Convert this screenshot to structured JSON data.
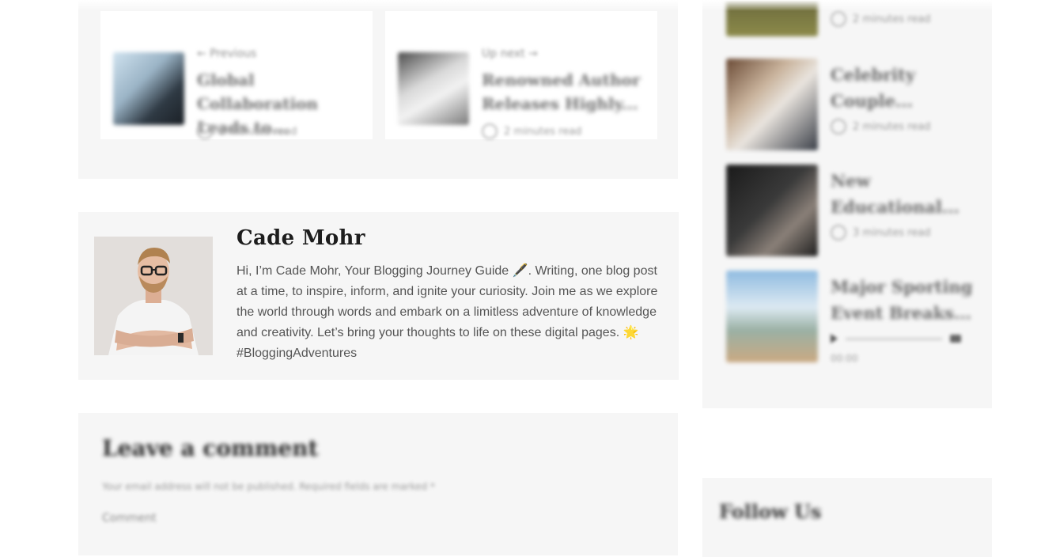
{
  "post_nav": {
    "previous": {
      "meta": "← Previous",
      "title": "Global Collaboration Leads to...",
      "read_time": "2 minutes read"
    },
    "next": {
      "meta": "Up next →",
      "title": "Renowned Author Releases Highly...",
      "read_time": "2 minutes read"
    }
  },
  "author": {
    "name": "Cade Mohr",
    "bio": "Hi, I’m Cade Mohr, Your Blogging Journey Guide 🖋️. Writing, one blog post at a time, to inspire, inform, and ignite your curiosity. Join me as we explore the world through words and embark on a limitless adventure of knowledge and creativity. Let’s bring your thoughts to life on these digital pages. 🌟 #BloggingAdventures"
  },
  "comment": {
    "title": "Leave a comment",
    "notice": "Your email address will not be published. Required fields are marked *",
    "comment_label": "Comment"
  },
  "sidebar": {
    "items": [
      {
        "title": "",
        "read_time": "2 minutes read"
      },
      {
        "title": "Celebrity Couple...",
        "read_time": "2 minutes read"
      },
      {
        "title": "New Educational...",
        "read_time": "3 minutes read"
      },
      {
        "title": "Major Sporting Event Breaks...",
        "audio_time": "00:00"
      }
    ],
    "follow_title": "Follow Us"
  }
}
